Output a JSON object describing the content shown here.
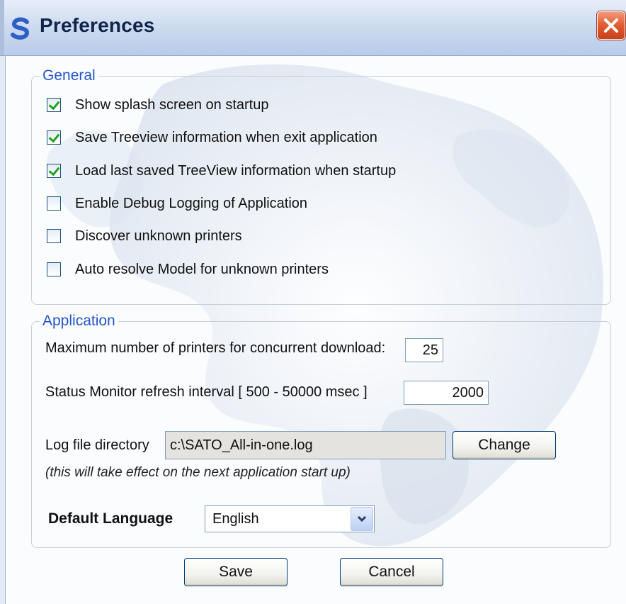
{
  "window": {
    "title": "Preferences"
  },
  "general": {
    "legend": "General",
    "options": [
      {
        "label": "Show splash screen on startup",
        "checked": true
      },
      {
        "label": "Save Treeview information when exit application",
        "checked": true
      },
      {
        "label": "Load last saved TreeView information when startup",
        "checked": true
      },
      {
        "label": "Enable Debug Logging of Application",
        "checked": false
      },
      {
        "label": "Discover unknown printers",
        "checked": false
      },
      {
        "label": "Auto resolve Model for unknown printers",
        "checked": false
      }
    ]
  },
  "application": {
    "legend": "Application",
    "max_printers_label": "Maximum number of printers for concurrent download:",
    "max_printers_value": "25",
    "refresh_label": "Status Monitor refresh interval [ 500 - 50000 msec ]",
    "refresh_value": "2000",
    "log_dir_label": "Log file directory",
    "log_dir_value": "c:\\SATO_All-in-one.log",
    "change_label": "Change",
    "note": "(this will take effect on the next application start up)",
    "language_label": "Default Language",
    "language_value": "English"
  },
  "buttons": {
    "save": "Save",
    "cancel": "Cancel"
  },
  "colors": {
    "accent": "#2457c9",
    "titlebar": "#cfdcf0",
    "close": "#e05a30",
    "check": "#21a121"
  }
}
